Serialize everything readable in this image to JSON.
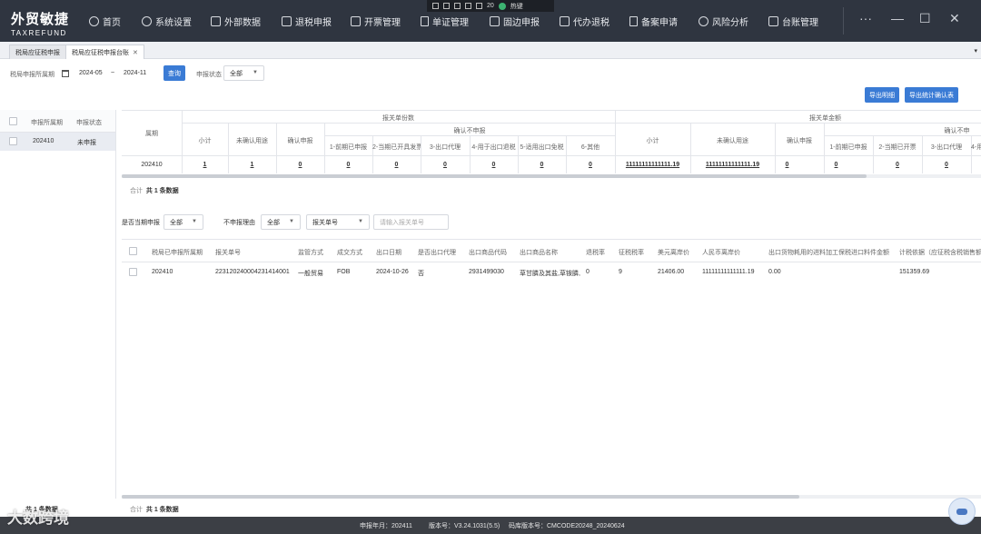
{
  "app": {
    "logo_cn": "外贸敏捷",
    "logo_en": "TAXREFUND"
  },
  "nav": [
    {
      "label": "首页",
      "icon": "home-icon"
    },
    {
      "label": "系统设置",
      "icon": "gear-icon"
    },
    {
      "label": "外部数据",
      "icon": "data-icon"
    },
    {
      "label": "退税申报",
      "icon": "declare-icon"
    },
    {
      "label": "开票管理",
      "icon": "invoice-icon"
    },
    {
      "label": "单证管理",
      "icon": "document-icon"
    },
    {
      "label": "固边申报",
      "icon": "mail-icon"
    },
    {
      "label": "代办退税",
      "icon": "agent-icon"
    },
    {
      "label": "备案申请",
      "icon": "file-icon"
    },
    {
      "label": "风险分析",
      "icon": "pie-icon"
    },
    {
      "label": "台账管理",
      "icon": "ledger-icon"
    }
  ],
  "tray": {
    "count": "20",
    "status": "热键"
  },
  "window_controls": {
    "more": "···",
    "minimize": "—",
    "maximize": "☐",
    "close": "✕"
  },
  "tabs": [
    {
      "label": "税局应征税申报"
    },
    {
      "label": "税局应征税申报台账"
    }
  ],
  "filters": {
    "period_label": "税局申报所属期",
    "period_start": "2024-05",
    "period_sep": "~",
    "period_end": "2024-11",
    "query_button": "查询",
    "status_label": "申报状态",
    "status_value": "全部"
  },
  "actions": {
    "export_detail": "导出明细",
    "export_stats": "导出统计确认表"
  },
  "left_table": {
    "headers": [
      "申报所属期",
      "申报状态"
    ],
    "rows": [
      {
        "period": "202410",
        "status": "未申报"
      }
    ]
  },
  "upper_table": {
    "period_header": "属期",
    "group_count": "报关单份数",
    "group_amount": "报关单金额",
    "sub_subtotal": "小计",
    "sub_unconfirmed": "未确认用途",
    "sub_confirm_declare": "确认申报",
    "sub_confirm_not": "确认不申报",
    "sub_confirm_not_short": "确认不申",
    "detail_cols": [
      "1-前期已申报",
      "2-当期已开具发票",
      "3-出口代理",
      "4-用于出口退税",
      "5-适用出口免税",
      "6-其他"
    ],
    "amount_detail_cols": [
      "1-前期已申报",
      "2-当期已开票",
      "3-出口代理",
      "4-用"
    ],
    "row": {
      "period": "202410",
      "subtotal": "1",
      "unconfirmed": "1",
      "confirm": "0",
      "details": [
        "0",
        "0",
        "0",
        "0",
        "0",
        "0"
      ],
      "amt_subtotal": "11111111111111.19",
      "amt_unconfirmed": "11111111111111.19",
      "amt_confirm": "0",
      "amt_details": [
        "0",
        "0",
        "0"
      ]
    },
    "total_text": "合计",
    "total_count": "共 1 条数据"
  },
  "lower_filters": {
    "current_declare_label": "是否当期申报",
    "current_declare_value": "全部",
    "not_declare_reason_label": "不申报理由",
    "not_declare_reason_value": "全部",
    "field_select": "报关单号",
    "search_placeholder": "请输入报关单号"
  },
  "lower_table": {
    "headers": [
      "税局已申报所属期",
      "报关单号",
      "监管方式",
      "成交方式",
      "出口日期",
      "是否出口代理",
      "出口商品代码",
      "出口商品名称",
      "退税率",
      "征税税率",
      "美元离岸价",
      "人民币离岸价",
      "出口货物耗用的进料加工保税进口料件金额",
      "计税依据（应征税含税销售额"
    ],
    "row": [
      "202410",
      "22312024000423141400​1",
      "一般贸易",
      "FOB",
      "2024-10-26",
      "否",
      "2931499030",
      "草甘膦及其盐,草铵膦,",
      "0",
      "9",
      "21406.00",
      "11111111111111.19",
      "0.00",
      "151359.69"
    ],
    "total_text": "合计",
    "total_count": "共 1 条数据"
  },
  "status_bar": {
    "period": "申报年月：202411",
    "version": "版本号：V3.24.1031(5.5)",
    "db_version": "码库版本号：CMCODE20248_20240624"
  },
  "watermark": "大数跨境",
  "left_footer": "共 1 条数据"
}
